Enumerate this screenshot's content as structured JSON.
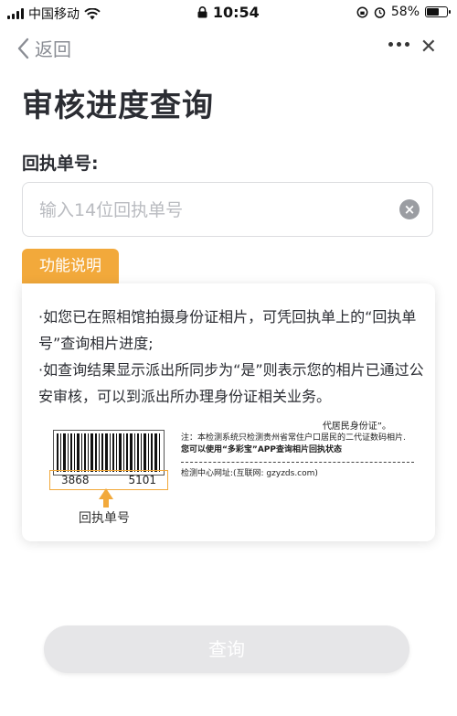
{
  "status_bar": {
    "carrier": "中国移动",
    "time": "10:54",
    "battery": "58%",
    "battery_level": 0.58
  },
  "nav": {
    "back_label": "返回",
    "more_icon": "more-icon",
    "close_icon": "close-icon"
  },
  "page": {
    "title": "审核进度查询",
    "field_label": "回执单号:",
    "input_value": "",
    "input_placeholder": "输入14位回执单号"
  },
  "info": {
    "tag_label": "功能说明",
    "lines": [
      "·如您已在照相馆拍摄身份证相片，可凭回执单上的“回执单号”查询相片进度;",
      "·如查询结果显示派出所同步为“是”则表示您的相片已通过公安审核，可以到派出所办理身份证相关业务。"
    ],
    "example": {
      "number_left": "3868",
      "number_right": "5101",
      "caption": "回执单号",
      "doc_line1": "代居民身份证”。",
      "doc_line2": "注：本检测系统只检测贵州省常住户口居民的二代证数码相片.",
      "doc_line3": "您可以使用“多彩宝”APP查询相片回执状态",
      "doc_line4": "检测中心网址:(互联网: gzyzds.com)"
    }
  },
  "actions": {
    "query_label": "查询"
  },
  "colors": {
    "accent": "#f2a93b",
    "button_disabled": "#e6e6e8"
  }
}
